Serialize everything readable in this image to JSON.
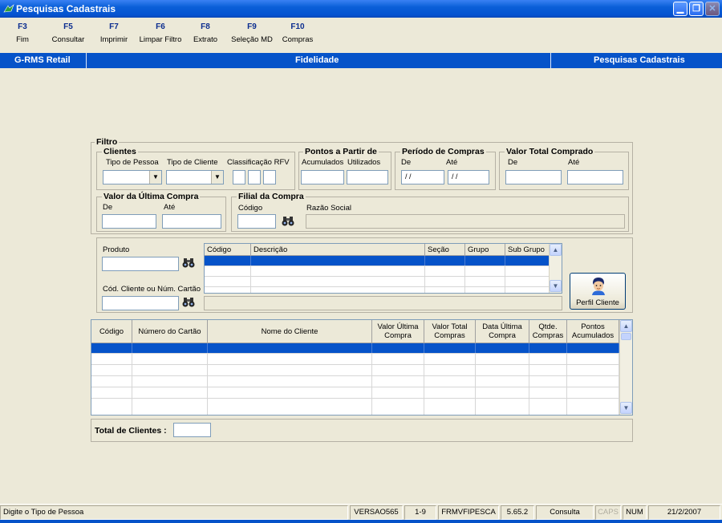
{
  "window": {
    "title": "Pesquisas Cadastrais"
  },
  "toolbar": [
    {
      "key": "F3",
      "label": "Fim"
    },
    {
      "key": "F5",
      "label": "Consultar"
    },
    {
      "key": "F7",
      "label": "Imprimir"
    },
    {
      "key": "F6",
      "label": "Limpar Filtro"
    },
    {
      "key": "F8",
      "label": "Extrato"
    },
    {
      "key": "F9",
      "label": "Seleção MD"
    },
    {
      "key": "F10",
      "label": "Compras"
    }
  ],
  "band": {
    "left": "G-RMS Retail",
    "center": "Fidelidade",
    "right": "Pesquisas Cadastrais"
  },
  "filtro": {
    "title": "Filtro",
    "clientes": {
      "title": "Clientes",
      "tipo_pessoa": "Tipo de Pessoa",
      "tipo_cliente": "Tipo de Cliente",
      "classificacao": "Classificação RFV"
    },
    "pontos": {
      "title": "Pontos a Partir de",
      "acumulados": "Acumulados",
      "utilizados": "Utilizados"
    },
    "periodo": {
      "title": "Período de Compras",
      "de": "De",
      "ate": "Até",
      "de_value": "/ /",
      "ate_value": "/ /"
    },
    "valor_total": {
      "title": "Valor Total Comprado",
      "de": "De",
      "ate": "Até"
    },
    "ultima_compra": {
      "title": "Valor da Última Compra",
      "de": "De",
      "ate": "Até"
    },
    "filial": {
      "title": "Filial da Compra",
      "codigo": "Código",
      "razao": "Razão Social"
    }
  },
  "produto": {
    "label": "Produto",
    "cod_cliente_label": "Cód. Cliente ou Núm. Cartão",
    "columns": [
      "Código",
      "Descrição",
      "Seção",
      "Grupo",
      "Sub Grupo"
    ]
  },
  "perfil_button": "Perfil Cliente",
  "clientes_grid": {
    "columns": [
      "Código",
      "Número do Cartão",
      "Nome do Cliente",
      "Valor Última Compra",
      "Valor Total Compras",
      "Data Última Compra",
      "Qtde. Compras",
      "Pontos Acumulados"
    ]
  },
  "total": {
    "label": "Total de Clientes :"
  },
  "status": {
    "message": "Digite o Tipo de Pessoa",
    "version": "VERSAO565",
    "page": "1-9",
    "form": "FRMVFIPESCA",
    "build": "5.65.2",
    "mode": "Consulta",
    "caps": "CAPS",
    "num": "NUM",
    "date": "21/2/2007"
  },
  "icons": {
    "app": "app-icon",
    "find": "binoculars-icon",
    "person": "person-icon"
  }
}
